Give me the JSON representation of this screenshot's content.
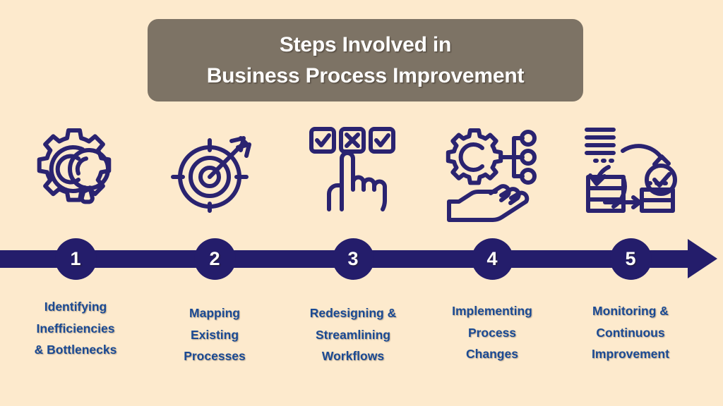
{
  "colors": {
    "background": "#fdeacd",
    "navy": "#241d6b",
    "banner": "#7d7365",
    "label_blue": "#1b4a93",
    "white": "#ffffff"
  },
  "title": {
    "line1": "Steps Involved in",
    "line2": "Business Process Improvement"
  },
  "timeline": {
    "direction": "left-to-right",
    "arrow_name": "timeline-arrow"
  },
  "steps": [
    {
      "number": "1",
      "icon": "gear-magnifier-icon",
      "label_lines": [
        "Identifying",
        "Inefficiencies",
        "& Bottlenecks"
      ],
      "label_full": "Identifying Inefficiencies & Bottlenecks"
    },
    {
      "number": "2",
      "icon": "target-arrow-icon",
      "label_lines": [
        "Mapping",
        "Existing",
        "Processes"
      ],
      "label_full": "Mapping Existing Processes"
    },
    {
      "number": "3",
      "icon": "checkbox-hand-icon",
      "label_lines": [
        "Redesigning &",
        "Streamlining",
        "Workflows"
      ],
      "label_full": "Redesigning & Streamlining Workflows"
    },
    {
      "number": "4",
      "icon": "gear-network-hand-icon",
      "label_lines": [
        "Implementing",
        "Process",
        "Changes"
      ],
      "label_full": "Implementing Process Changes"
    },
    {
      "number": "5",
      "icon": "monitoring-cycle-icon",
      "label_lines": [
        "Monitoring &",
        "Continuous",
        "Improvement"
      ],
      "label_full": "Monitoring & Continuous Improvement"
    }
  ]
}
